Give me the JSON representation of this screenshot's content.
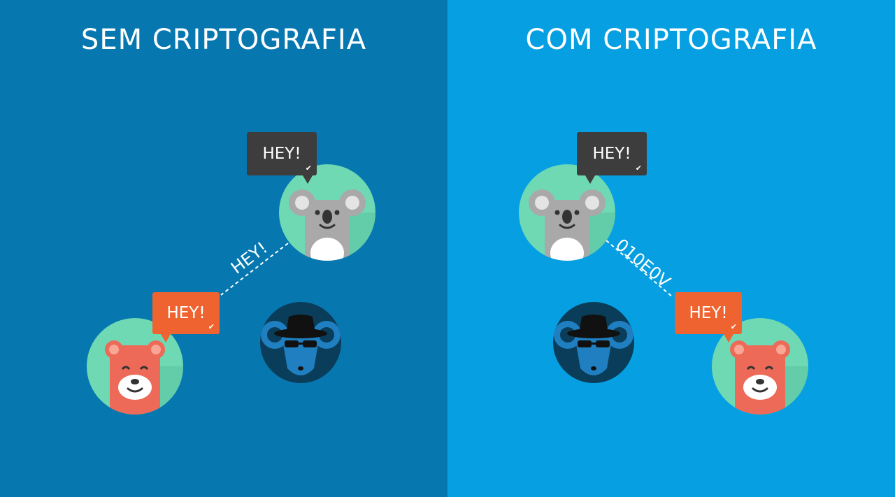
{
  "colors": {
    "left_bg": "#0777b0",
    "right_bg": "#069fe2",
    "avatar_green": "#6fd9b4",
    "bubble_dark": "#3d3d3d",
    "bubble_orange": "#ef6330",
    "spy_dark": "#0a3d59"
  },
  "left": {
    "title": "SEM CRIPTOGRAFIA",
    "koala_bubble": "HEY!",
    "bear_bubble": "HEY!",
    "wire_text": "HEY!"
  },
  "right": {
    "title": "COM CRIPTOGRAFIA",
    "koala_bubble": "HEY!",
    "bear_bubble": "HEY!",
    "wire_text": "010E0V"
  },
  "icons": {
    "koala": "koala-avatar-icon",
    "bear": "bear-avatar-icon",
    "spy": "spy-mouse-icon",
    "read_tick": "checkmark-icon"
  }
}
